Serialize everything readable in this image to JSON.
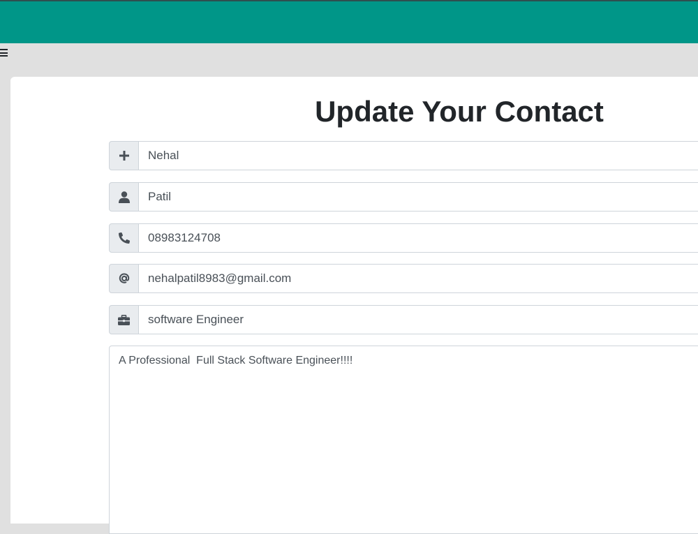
{
  "header": {
    "color": "#009688",
    "menu_icon": "hamburger-menu-icon"
  },
  "form": {
    "title": "Update Your Contact",
    "fields": [
      {
        "icon": "plus-icon",
        "value": "Nehal"
      },
      {
        "icon": "user-icon",
        "value": "Patil"
      },
      {
        "icon": "phone-icon",
        "value": "08983124708"
      },
      {
        "icon": "at-sign-icon",
        "value": "nehalpatil8983@gmail.com"
      },
      {
        "icon": "briefcase-icon",
        "value": "software Engineer"
      }
    ],
    "description": "A Professional  Full Stack Software Engineer!!!!"
  }
}
